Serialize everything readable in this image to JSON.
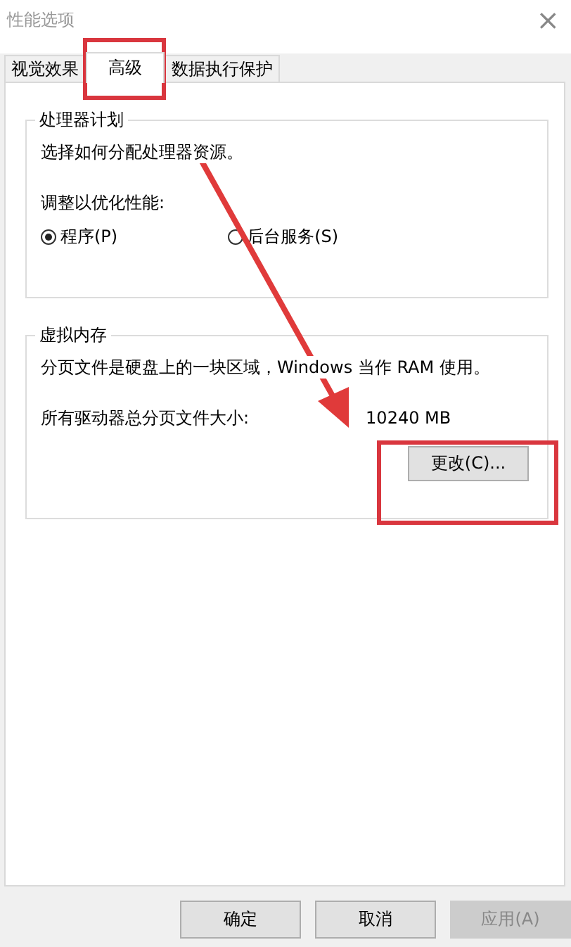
{
  "window": {
    "title": "性能选项",
    "close": "×"
  },
  "tabs": [
    {
      "label": "视觉效果",
      "selected": false
    },
    {
      "label": "高级",
      "selected": true
    },
    {
      "label": "数据执行保护",
      "selected": false
    }
  ],
  "processor_group": {
    "title": "处理器计划",
    "description": "选择如何分配处理器资源。",
    "prompt": "调整以优化性能:",
    "options": [
      {
        "label": "程序(P)",
        "selected": true
      },
      {
        "label": "后台服务(S)",
        "selected": false
      }
    ]
  },
  "memory_group": {
    "title": "虚拟内存",
    "description": "分页文件是硬盘上的一块区域，Windows 当作 RAM 使用。",
    "size_label": "所有驱动器总分页文件大小:",
    "size_value": "10240 MB",
    "button": "更改(C)..."
  },
  "buttons": [
    {
      "label": "确定",
      "disabled": false
    },
    {
      "label": "取消",
      "disabled": false
    },
    {
      "label": "应用(A)",
      "disabled": true
    }
  ]
}
